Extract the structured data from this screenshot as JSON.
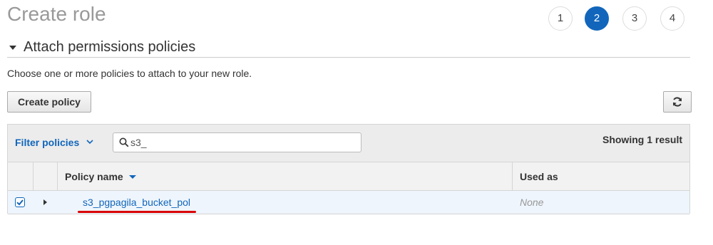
{
  "page": {
    "title": "Create role"
  },
  "steps": [
    {
      "label": "1",
      "active": false
    },
    {
      "label": "2",
      "active": true
    },
    {
      "label": "3",
      "active": false
    },
    {
      "label": "4",
      "active": false
    }
  ],
  "section": {
    "title": "Attach permissions policies"
  },
  "intro": "Choose one or more policies to attach to your new role.",
  "toolbar": {
    "create_policy_label": "Create policy",
    "refresh_icon": "refresh-icon"
  },
  "filter": {
    "label": "Filter policies",
    "search_value": "s3_"
  },
  "results": {
    "count_text": "Showing 1 result"
  },
  "table": {
    "columns": {
      "policy_name": "Policy name",
      "used_as": "Used as"
    },
    "rows": [
      {
        "checked": true,
        "policy_name": "s3_pgpagila_bucket_pol",
        "used_as": "None"
      }
    ]
  },
  "colors": {
    "accent": "#1166bb",
    "annotation": "#d90000"
  }
}
